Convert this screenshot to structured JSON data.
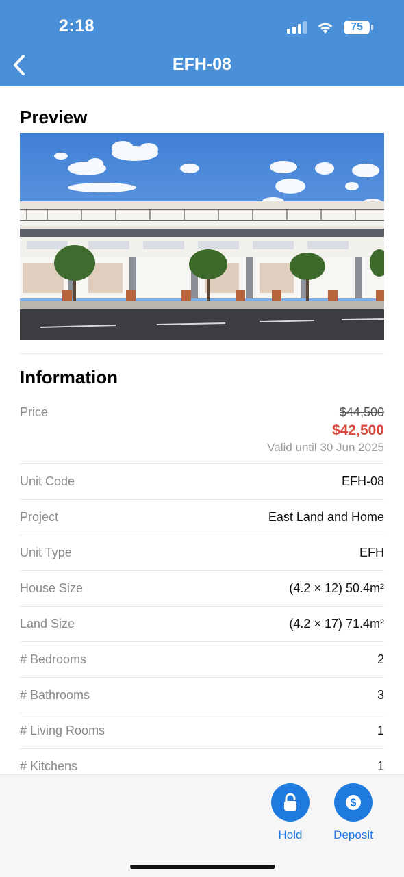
{
  "status_bar": {
    "time": "2:18",
    "battery": "75"
  },
  "header": {
    "title": "EFH-08"
  },
  "preview": {
    "title": "Preview"
  },
  "information": {
    "title": "Information",
    "price": {
      "label": "Price",
      "original": "$44,500",
      "discounted": "$42,500",
      "valid_until": "Valid until 30 Jun 2025"
    },
    "rows": [
      {
        "label": "Unit Code",
        "value": "EFH-08"
      },
      {
        "label": "Project",
        "value": "East Land and Home"
      },
      {
        "label": "Unit Type",
        "value": "EFH"
      },
      {
        "label": "House Size",
        "value": "(4.2 × 12) 50.4m²"
      },
      {
        "label": "Land Size",
        "value": "(4.2 × 17) 71.4m²"
      },
      {
        "label": "# Bedrooms",
        "value": "2"
      },
      {
        "label": "# Bathrooms",
        "value": "3"
      },
      {
        "label": "# Living Rooms",
        "value": "1"
      },
      {
        "label": "# Kitchens",
        "value": "1"
      }
    ]
  },
  "actions": {
    "hold_label": "Hold",
    "deposit_label": "Deposit"
  },
  "colors": {
    "header": "#4a90d9",
    "accent": "#1f7ae0",
    "discount_price": "#d9493a"
  },
  "icons": {
    "back": "chevron-left-icon",
    "hold": "lock-icon",
    "deposit": "dollar-icon"
  }
}
